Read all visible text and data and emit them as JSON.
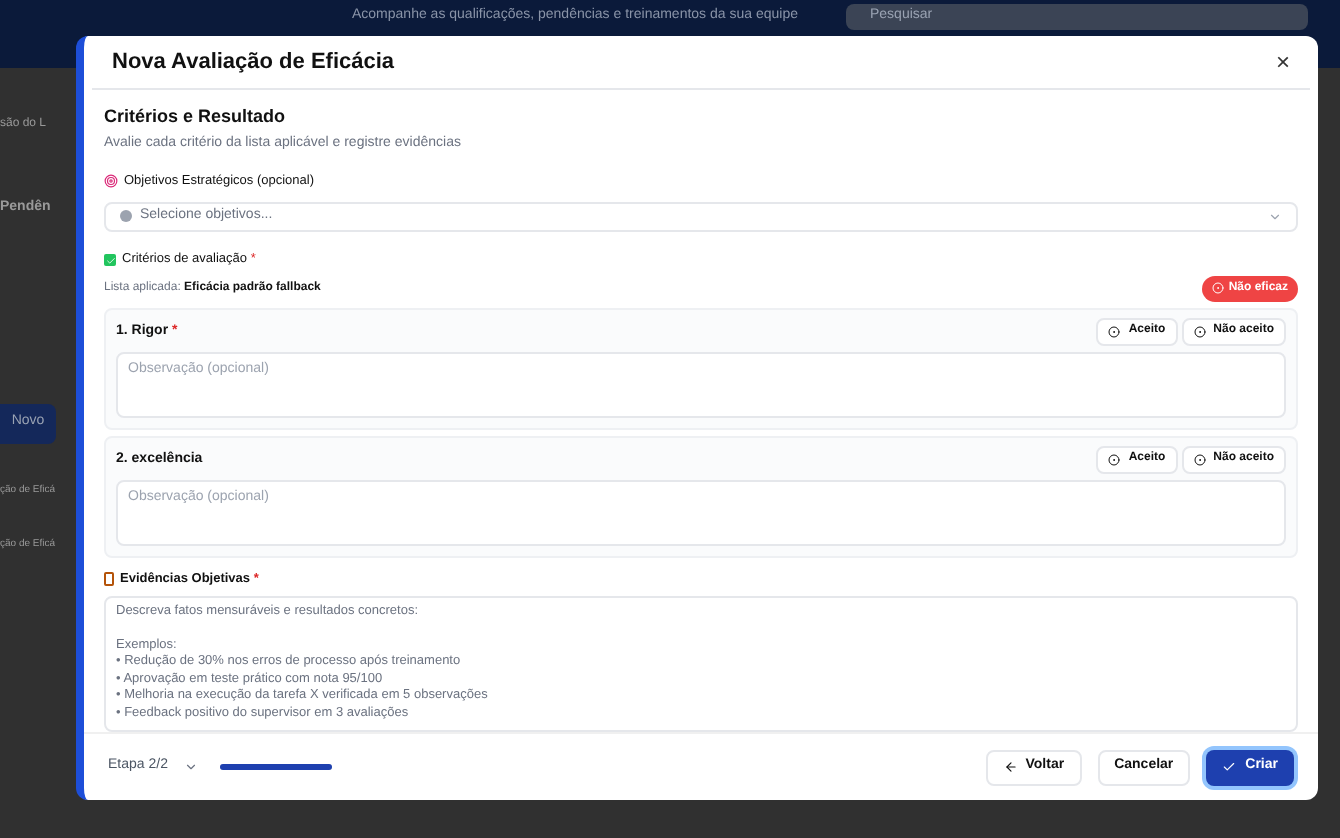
{
  "background": {
    "header_subtitle": "Acompanhe as qualificações, pendências e treinamentos da sua equipe",
    "search_placeholder": "Pesquisar",
    "page_title": "são do L",
    "section_title": "Pendên",
    "new_button": "Novo",
    "list_items": [
      "ção de Eficá",
      "ção de Eficá"
    ]
  },
  "dialog": {
    "title": "Nova Avaliação de Eficácia",
    "close": "×",
    "section": {
      "title": "Critérios e Resultado",
      "subtitle": "Avalie cada critério da lista aplicável e registre evidências"
    },
    "objectives": {
      "label": "Objetivos Estratégicos (opcional)",
      "placeholder": "Selecione objetivos..."
    },
    "criteria": {
      "label": "Critérios de avaliação",
      "required": "*",
      "applied_label": "Lista aplicada:",
      "applied_value": "Eficácia padrão fallback",
      "result_badge": "Não eficaz",
      "items": [
        {
          "title": "1. Rigor",
          "required": true,
          "accept": "Aceito",
          "reject": "Não aceito",
          "placeholder": "Observação (opcional)"
        },
        {
          "title": "2. excelência",
          "required": false,
          "accept": "Aceito",
          "reject": "Não aceito",
          "placeholder": "Observação (opcional)"
        }
      ]
    },
    "evidence": {
      "label": "Evidências Objetivas",
      "required": "*",
      "placeholder": "Descreva fatos mensuráveis e resultados concretos:\n\nExemplos:\n• Redução de 30% nos erros de processo após treinamento\n• Aprovação em teste prático com nota 95/100\n• Melhoria na execução da tarefa X verificada em 5 observações\n• Feedback positivo do supervisor em 3 avaliações"
    },
    "footer": {
      "step": "Etapa 2/2",
      "progress": {
        "level": 1
      },
      "back": "Voltar",
      "cancel": "Cancelar",
      "create": "Criar"
    }
  }
}
